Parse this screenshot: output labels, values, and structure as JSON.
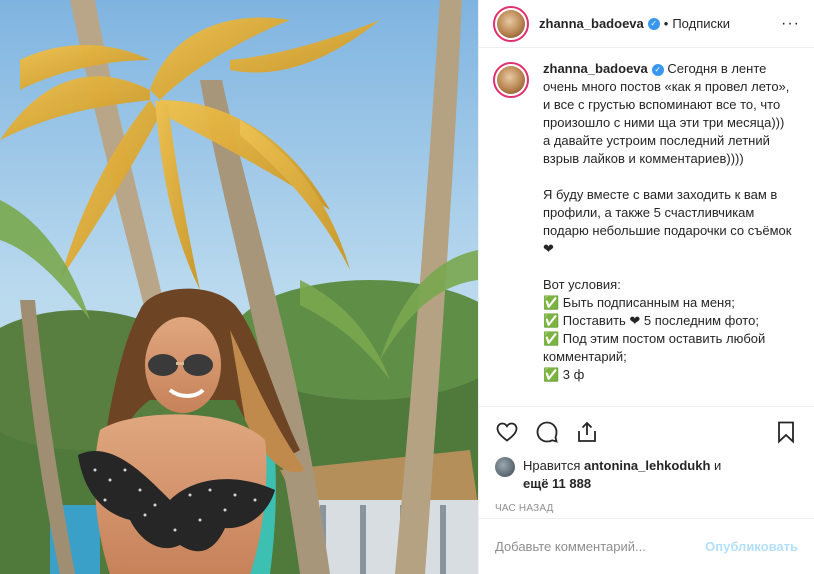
{
  "post": {
    "username": "zhanna_badoeva",
    "follow_label": "Подписки",
    "dot": "•",
    "more": "···"
  },
  "caption": {
    "username": "zhanna_badoeva",
    "paragraphs": [
      "Сегодня в ленте очень много постов «как я провел лето», и все с грустью вспоминают все то, что произошло с ними ща эти три месяца))) а давайте устроим последний летний взрыв лайков и комментариев))))",
      "Я буду вместе с вами заходить к вам в профили, а также 5 счастливчикам подарю небольшие подарочки со съёмок ❤",
      "Вот условия:\n✅ Быть подписанным на меня;\n✅ Поставить ❤ 5 последним фото;\n✅ Под этим постом оставить любой комментарий;\n✅ 3 ф"
    ]
  },
  "likes": {
    "prefix": "Нравится",
    "user": "antonina_lehkodukh",
    "and": "и",
    "more": "ещё 11 888"
  },
  "time_label": "ЧАС НАЗАД",
  "comment": {
    "placeholder": "Добавьте комментарий...",
    "publish_label": "Опубликовать"
  },
  "icons": {
    "like": "heart-icon",
    "comment": "comment-icon",
    "share": "share-icon",
    "save": "bookmark-icon"
  },
  "colors": {
    "verified": "#3897f0",
    "publish_disabled": "#b2dffc",
    "muted": "#8e8e8e"
  }
}
